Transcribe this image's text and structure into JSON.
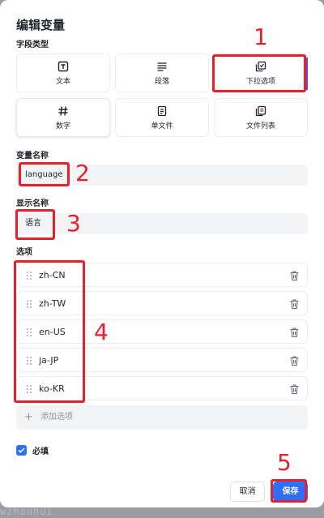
{
  "dialog": {
    "title": "编辑变量",
    "field_type_label": "字段类型",
    "field_types": [
      {
        "label": "文本",
        "icon": "text-box-icon"
      },
      {
        "label": "段落",
        "icon": "paragraph-lines-icon"
      },
      {
        "label": "下拉选项",
        "icon": "dropdown-copy-icon"
      },
      {
        "label": "数字",
        "icon": "hash-icon"
      },
      {
        "label": "单文件",
        "icon": "file-icon"
      },
      {
        "label": "文件列表",
        "icon": "file-list-icon"
      }
    ],
    "variable_name_label": "变量名称",
    "variable_name_value": "language",
    "display_name_label": "显示名称",
    "display_name_value": "语言",
    "options_label": "选项",
    "options": [
      "zh-CN",
      "zh-TW",
      "en-US",
      "ja-JP",
      "ko-KR"
    ],
    "add_option_label": "添加选项",
    "required_label": "必填",
    "required_checked": true,
    "cancel_label": "取消",
    "save_label": "保存"
  },
  "annotations": [
    "1",
    "2",
    "3",
    "4",
    "5"
  ],
  "watermark": "wzhouhui",
  "colors": {
    "primary": "#2f6ef6",
    "annotation": "#e8202b",
    "input_bg": "#f2f3f5",
    "accent_edge": "#6f3fe0"
  }
}
